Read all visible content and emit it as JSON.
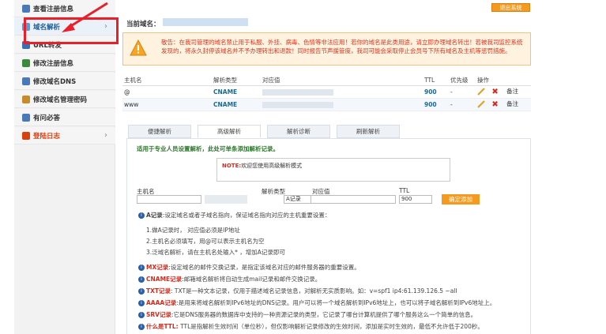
{
  "sidebar": {
    "items": [
      {
        "label": "查看注册信息"
      },
      {
        "label": "域名解析",
        "chevron": "›"
      },
      {
        "label": "URL转发"
      },
      {
        "label": "修改注册信息"
      },
      {
        "label": "修改域名DNS"
      },
      {
        "label": "修改域名管理密码"
      },
      {
        "label": "有问必答"
      },
      {
        "label": "登陆日志",
        "chevron": "›"
      }
    ]
  },
  "header": {
    "exit_label": "退出系统",
    "current_domain_label": "当前域名："
  },
  "warning": {
    "text": "敬告：在我司管理的域名禁止用于私服、外挂、病毒、色情等非法应用！若你的域名是此类用途，请立即办理域名转出！若被我司监控系统发现的，将永久封停该域名并不予办理转出和退款！同时报告节声援管度，我司可能会采取停止会员号下所有域名及主机等惩罚措施。"
  },
  "records": {
    "headers": [
      "主机名",
      "解析类型",
      "对应值",
      "TTL",
      "优先级",
      "操作"
    ],
    "rows": [
      {
        "host": "@",
        "type": "CNAME",
        "ttl": "900",
        "priority": "-",
        "note": "备注"
      },
      {
        "host": "www",
        "type": "CNAME",
        "ttl": "900",
        "priority": "-",
        "note": "备注"
      }
    ]
  },
  "tabs": [
    "便捷解析",
    "高级解析",
    "解析诊断",
    "刷新解析"
  ],
  "panel": {
    "title": "适用于专业人员设置解析，此处可单条添加解析记录。",
    "note_label": "NOTE:",
    "note_text": "欢迎您使用高级解析模式"
  },
  "form": {
    "host_label": "主机名",
    "type_label": "解析类型",
    "value_label": "对应值",
    "ttl_label": "TTL",
    "type_value": "A记录",
    "ttl_value": "900",
    "add_label": "确定添加"
  },
  "help": {
    "a_key": "A记录",
    "a_text": ":设定域名或者子域名指向，保证域名指向对应的主机重要设置：",
    "a_sub1": "1.做A记录时， 对应值必须是IP地址",
    "a_sub2": "2.主机名必须填写，用@可以表示主机名为空",
    "a_sub3": "3.泛域名解析，请在主机名处输入* ，增加A记录即可",
    "mx_key": "MX记录",
    "mx_text": ":设定域名的邮件交换记录，是指定该域名对应的邮件服务器的重要设置。",
    "cname_key": "CNAME记录",
    "cname_text": ":邮箱域名解析将自动生成mail记录和邮件交换记录。",
    "txt_key": "TXT记录",
    "txt_text": ": TXT是一种文本记录，仅用于描述域名记录信息，对解析无实质影响。如：v=spf1 ip4:61.139.126.5 ~all",
    "aaaa_key": "AAAA记录",
    "aaaa_text": ":是用来将域名解析到IPv6地址的DNS记录。用户可以将一个域名解析到IPv6地址上，也可以将子域名解析到IPv6地址上。",
    "srv_key": "SRV记录",
    "srv_text": ":它是DNS服务器的数据库中支持的一种资源记录的类型，它记录了哪台计算机提供了哪个服务这么一个简单的信息。",
    "ttl_key": "什么是TTL:",
    "ttl_text": " TTL是指解析生效时间（单位秒），但仅影响解析记录修改的生效时间，添加是实时生效的，最低不允许低于200秒。"
  }
}
